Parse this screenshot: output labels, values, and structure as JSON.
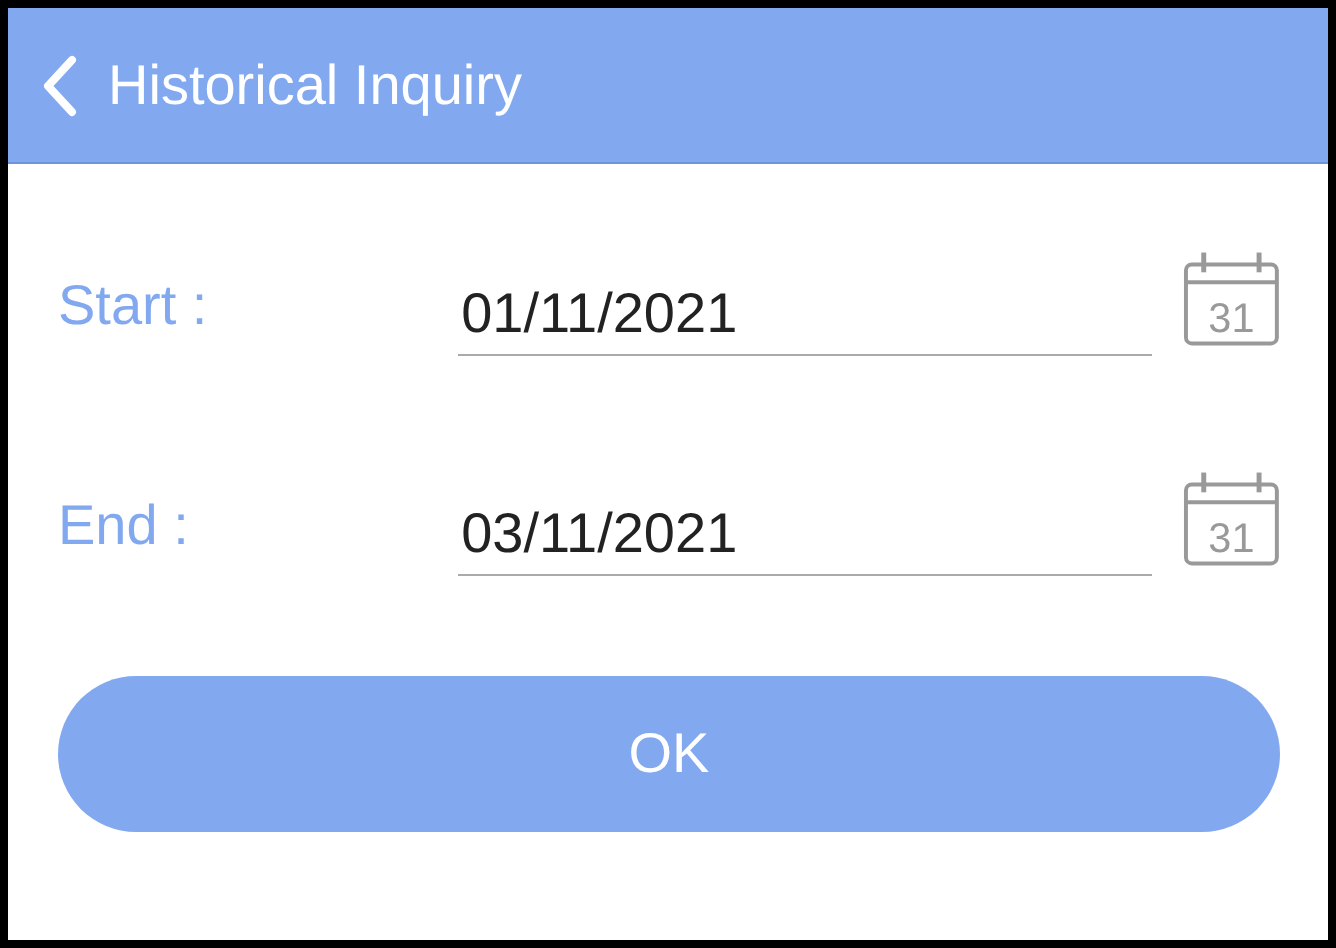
{
  "header": {
    "title": "Historical Inquiry"
  },
  "fields": [
    {
      "label": "Start :",
      "value": "01/11/2021",
      "calendar_day": "31"
    },
    {
      "label": "End :",
      "value": "03/11/2021",
      "calendar_day": "31"
    }
  ],
  "button": {
    "label": "OK"
  }
}
